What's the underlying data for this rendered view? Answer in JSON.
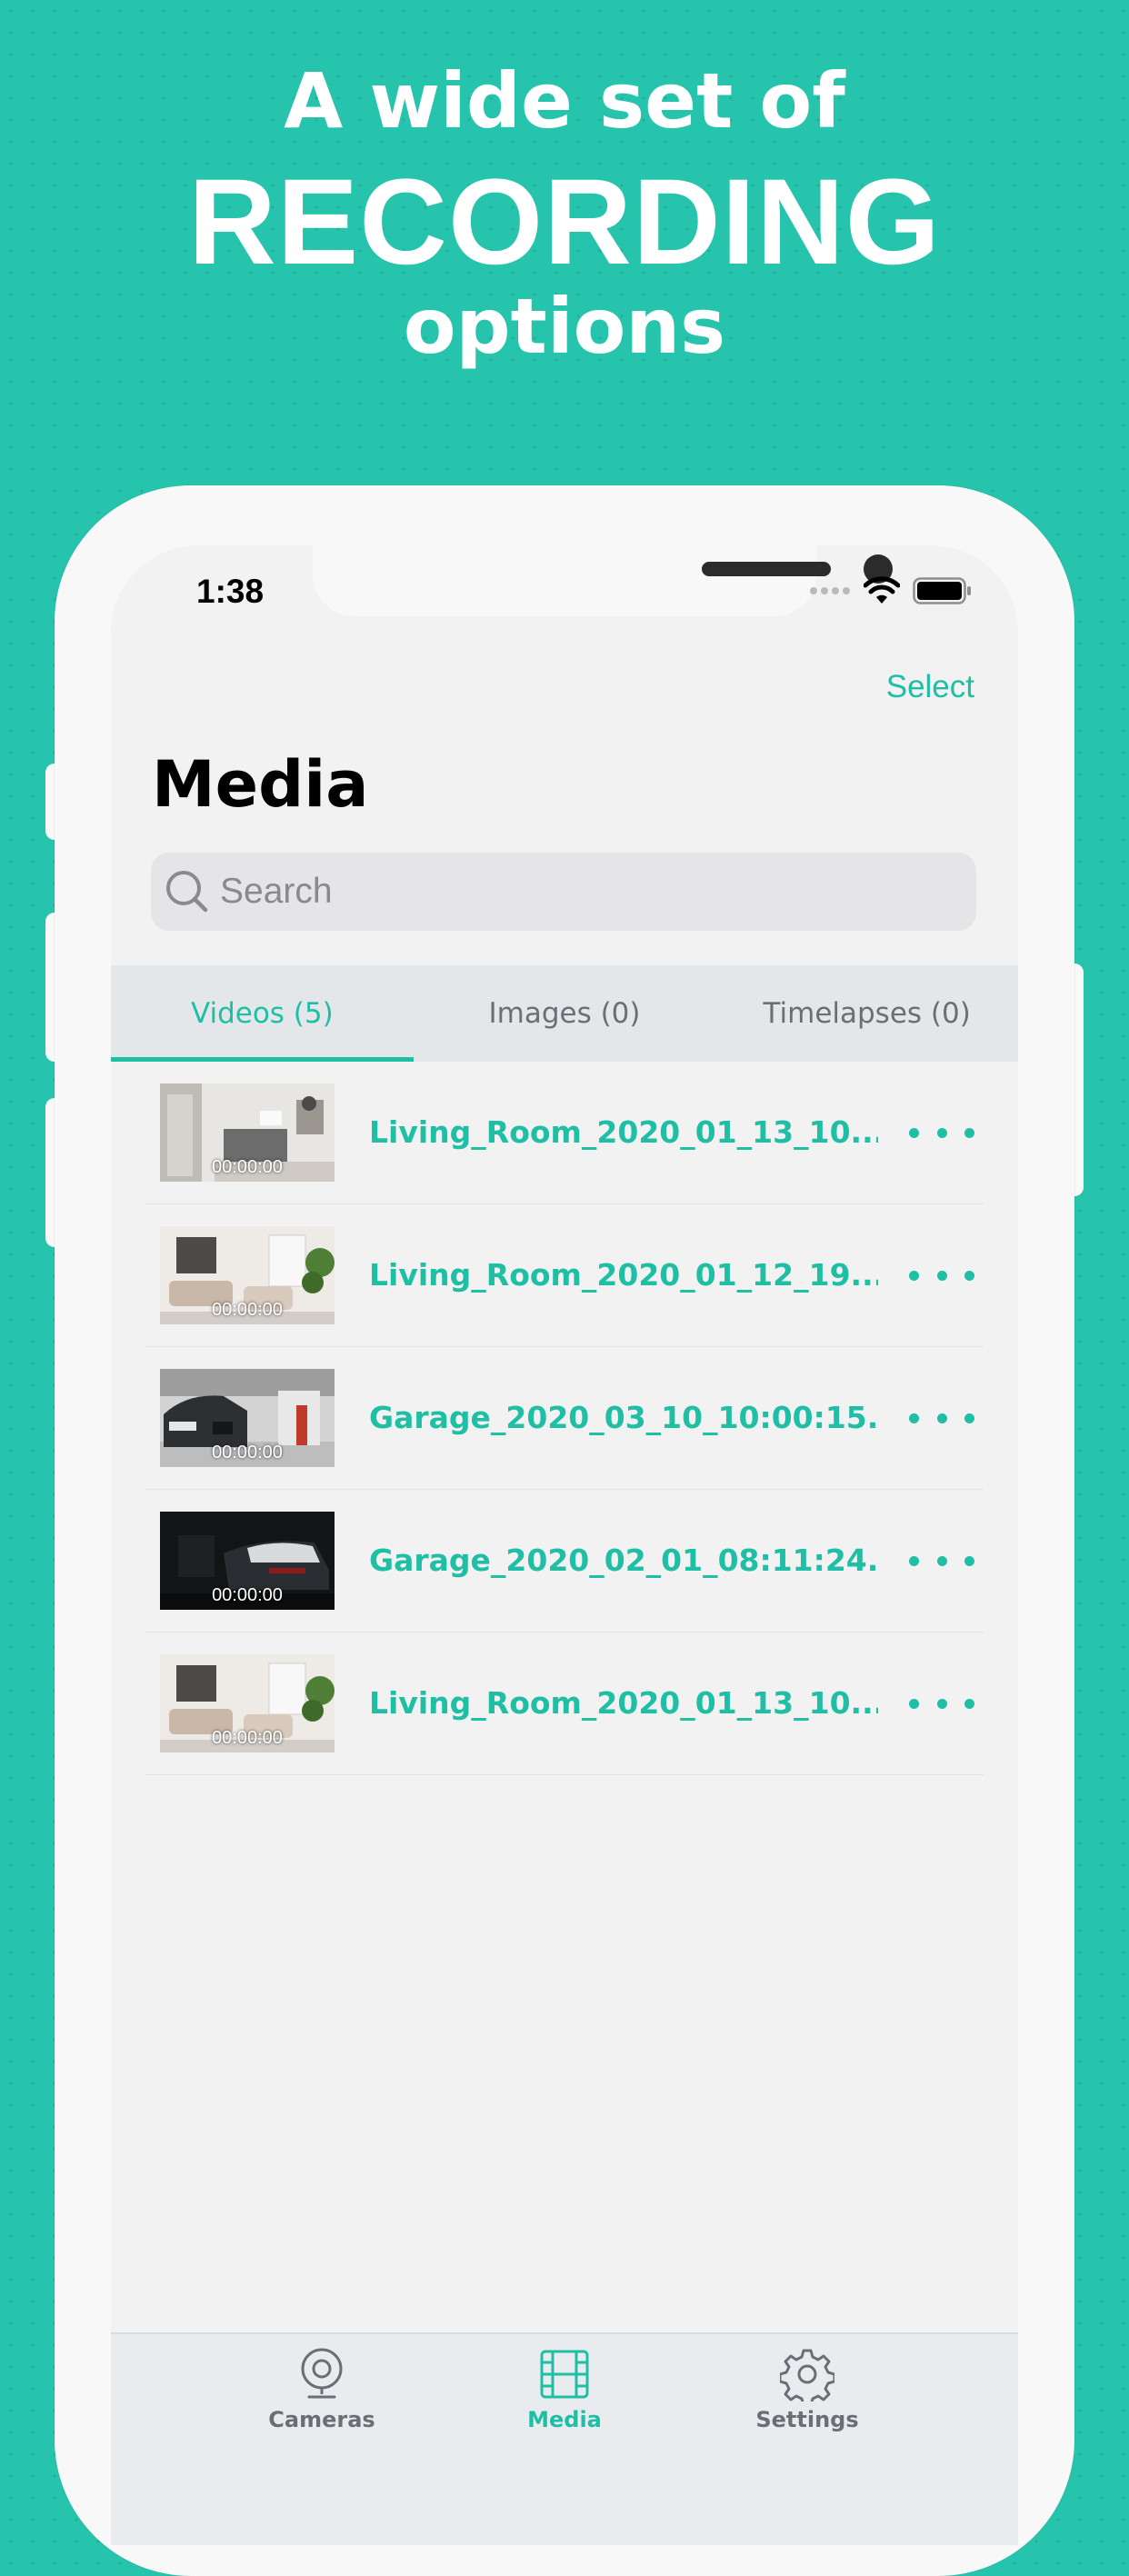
{
  "promo": {
    "line1": "A wide set of",
    "line2": "RECORDING",
    "line3": "options"
  },
  "status_bar": {
    "time": "1:38",
    "icons": [
      "signal-dots-icon",
      "wifi-icon",
      "battery-icon"
    ]
  },
  "nav": {
    "select_label": "Select",
    "title": "Media"
  },
  "search": {
    "placeholder": "Search"
  },
  "segments": [
    {
      "label": "Videos (5)",
      "active": true
    },
    {
      "label": "Images (0)",
      "active": false
    },
    {
      "label": "Timelapses (0)",
      "active": false
    }
  ],
  "videos": [
    {
      "name": "Living_Room_2020_01_13_10...",
      "duration": "00:00:00"
    },
    {
      "name": "Living_Room_2020_01_12_19...",
      "duration": "00:00:00"
    },
    {
      "name": "Garage_2020_03_10_10:00:15...",
      "duration": "00:00:00"
    },
    {
      "name": "Garage_2020_02_01_08:11:24...",
      "duration": "00:00:00"
    },
    {
      "name": "Living_Room_2020_01_13_10...",
      "duration": "00:00:00"
    }
  ],
  "tab_bar": [
    {
      "label": "Cameras",
      "icon": "camera-icon",
      "active": false
    },
    {
      "label": "Media",
      "icon": "film-icon",
      "active": true
    },
    {
      "label": "Settings",
      "icon": "gear-icon",
      "active": false
    }
  ],
  "colors": {
    "accent": "#1fbfa6",
    "background": "#26c4ad"
  }
}
